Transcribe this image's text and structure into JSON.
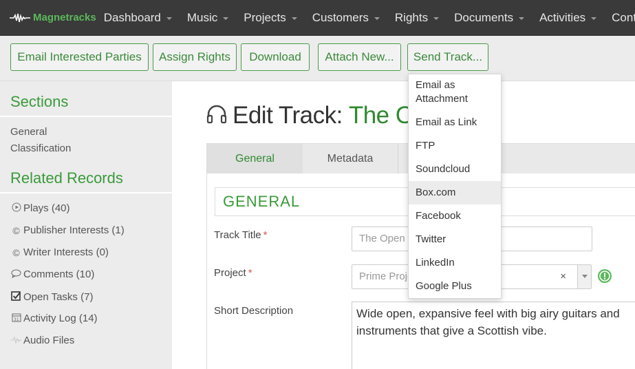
{
  "brand": {
    "name": "Magnetracks",
    "logo_icon": "waveform-icon"
  },
  "nav": {
    "items": [
      {
        "label": "Dashboard",
        "dropdown": true
      },
      {
        "label": "Music",
        "dropdown": true
      },
      {
        "label": "Projects",
        "dropdown": true
      },
      {
        "label": "Customers",
        "dropdown": true
      },
      {
        "label": "Rights",
        "dropdown": true
      },
      {
        "label": "Documents",
        "dropdown": true
      },
      {
        "label": "Activities",
        "dropdown": true
      },
      {
        "label": "Contr",
        "dropdown": false
      }
    ]
  },
  "toolbar": {
    "email_interested": "Email Interested Parties",
    "assign_rights": "Assign Rights",
    "download": "Download",
    "attach_new": "Attach New...",
    "send_track": "Send Track..."
  },
  "send_menu": {
    "items": [
      "Email as Attachment",
      "Email as Link",
      "FTP",
      "Soundcloud",
      "Box.com",
      "Facebook",
      "Twitter",
      "LinkedIn",
      "Google Plus"
    ],
    "highlighted": "Box.com"
  },
  "sidebar": {
    "sections_heading": "Sections",
    "sections": [
      "General",
      "Classification"
    ],
    "related_heading": "Related Records",
    "related": [
      {
        "label": "Plays (40)",
        "icon": "play-circle-icon"
      },
      {
        "label": "Publisher Interests (1)",
        "icon": "copyright-icon"
      },
      {
        "label": "Writer Interests (0)",
        "icon": "copyright-icon"
      },
      {
        "label": "Comments (10)",
        "icon": "comment-icon"
      },
      {
        "label": "Open Tasks (7)",
        "icon": "checkbox-icon"
      },
      {
        "label": "Activity Log (14)",
        "icon": "calendar-icon"
      },
      {
        "label": "Audio Files",
        "icon": "audio-icon"
      }
    ]
  },
  "main": {
    "title_prefix": "Edit Track:",
    "title_name": "The Op",
    "title_icon": "headphones-icon",
    "tabs": [
      "General",
      "Metadata"
    ],
    "active_tab": "General",
    "section_title": "GENERAL",
    "fields": {
      "track_title_label": "Track Title",
      "track_title_value": "The Open F",
      "project_label": "Project",
      "project_value": "Prime Proje",
      "project_clear": "×",
      "short_description_label": "Short Description",
      "short_description_value": "Wide open, expansive feel with big airy guitars and instruments that give a Scottish vibe.",
      "required_marker": "*"
    }
  },
  "colors": {
    "accent": "#3a9a3a",
    "nav_bg": "#3a3a3a",
    "required": "#d9534f"
  }
}
